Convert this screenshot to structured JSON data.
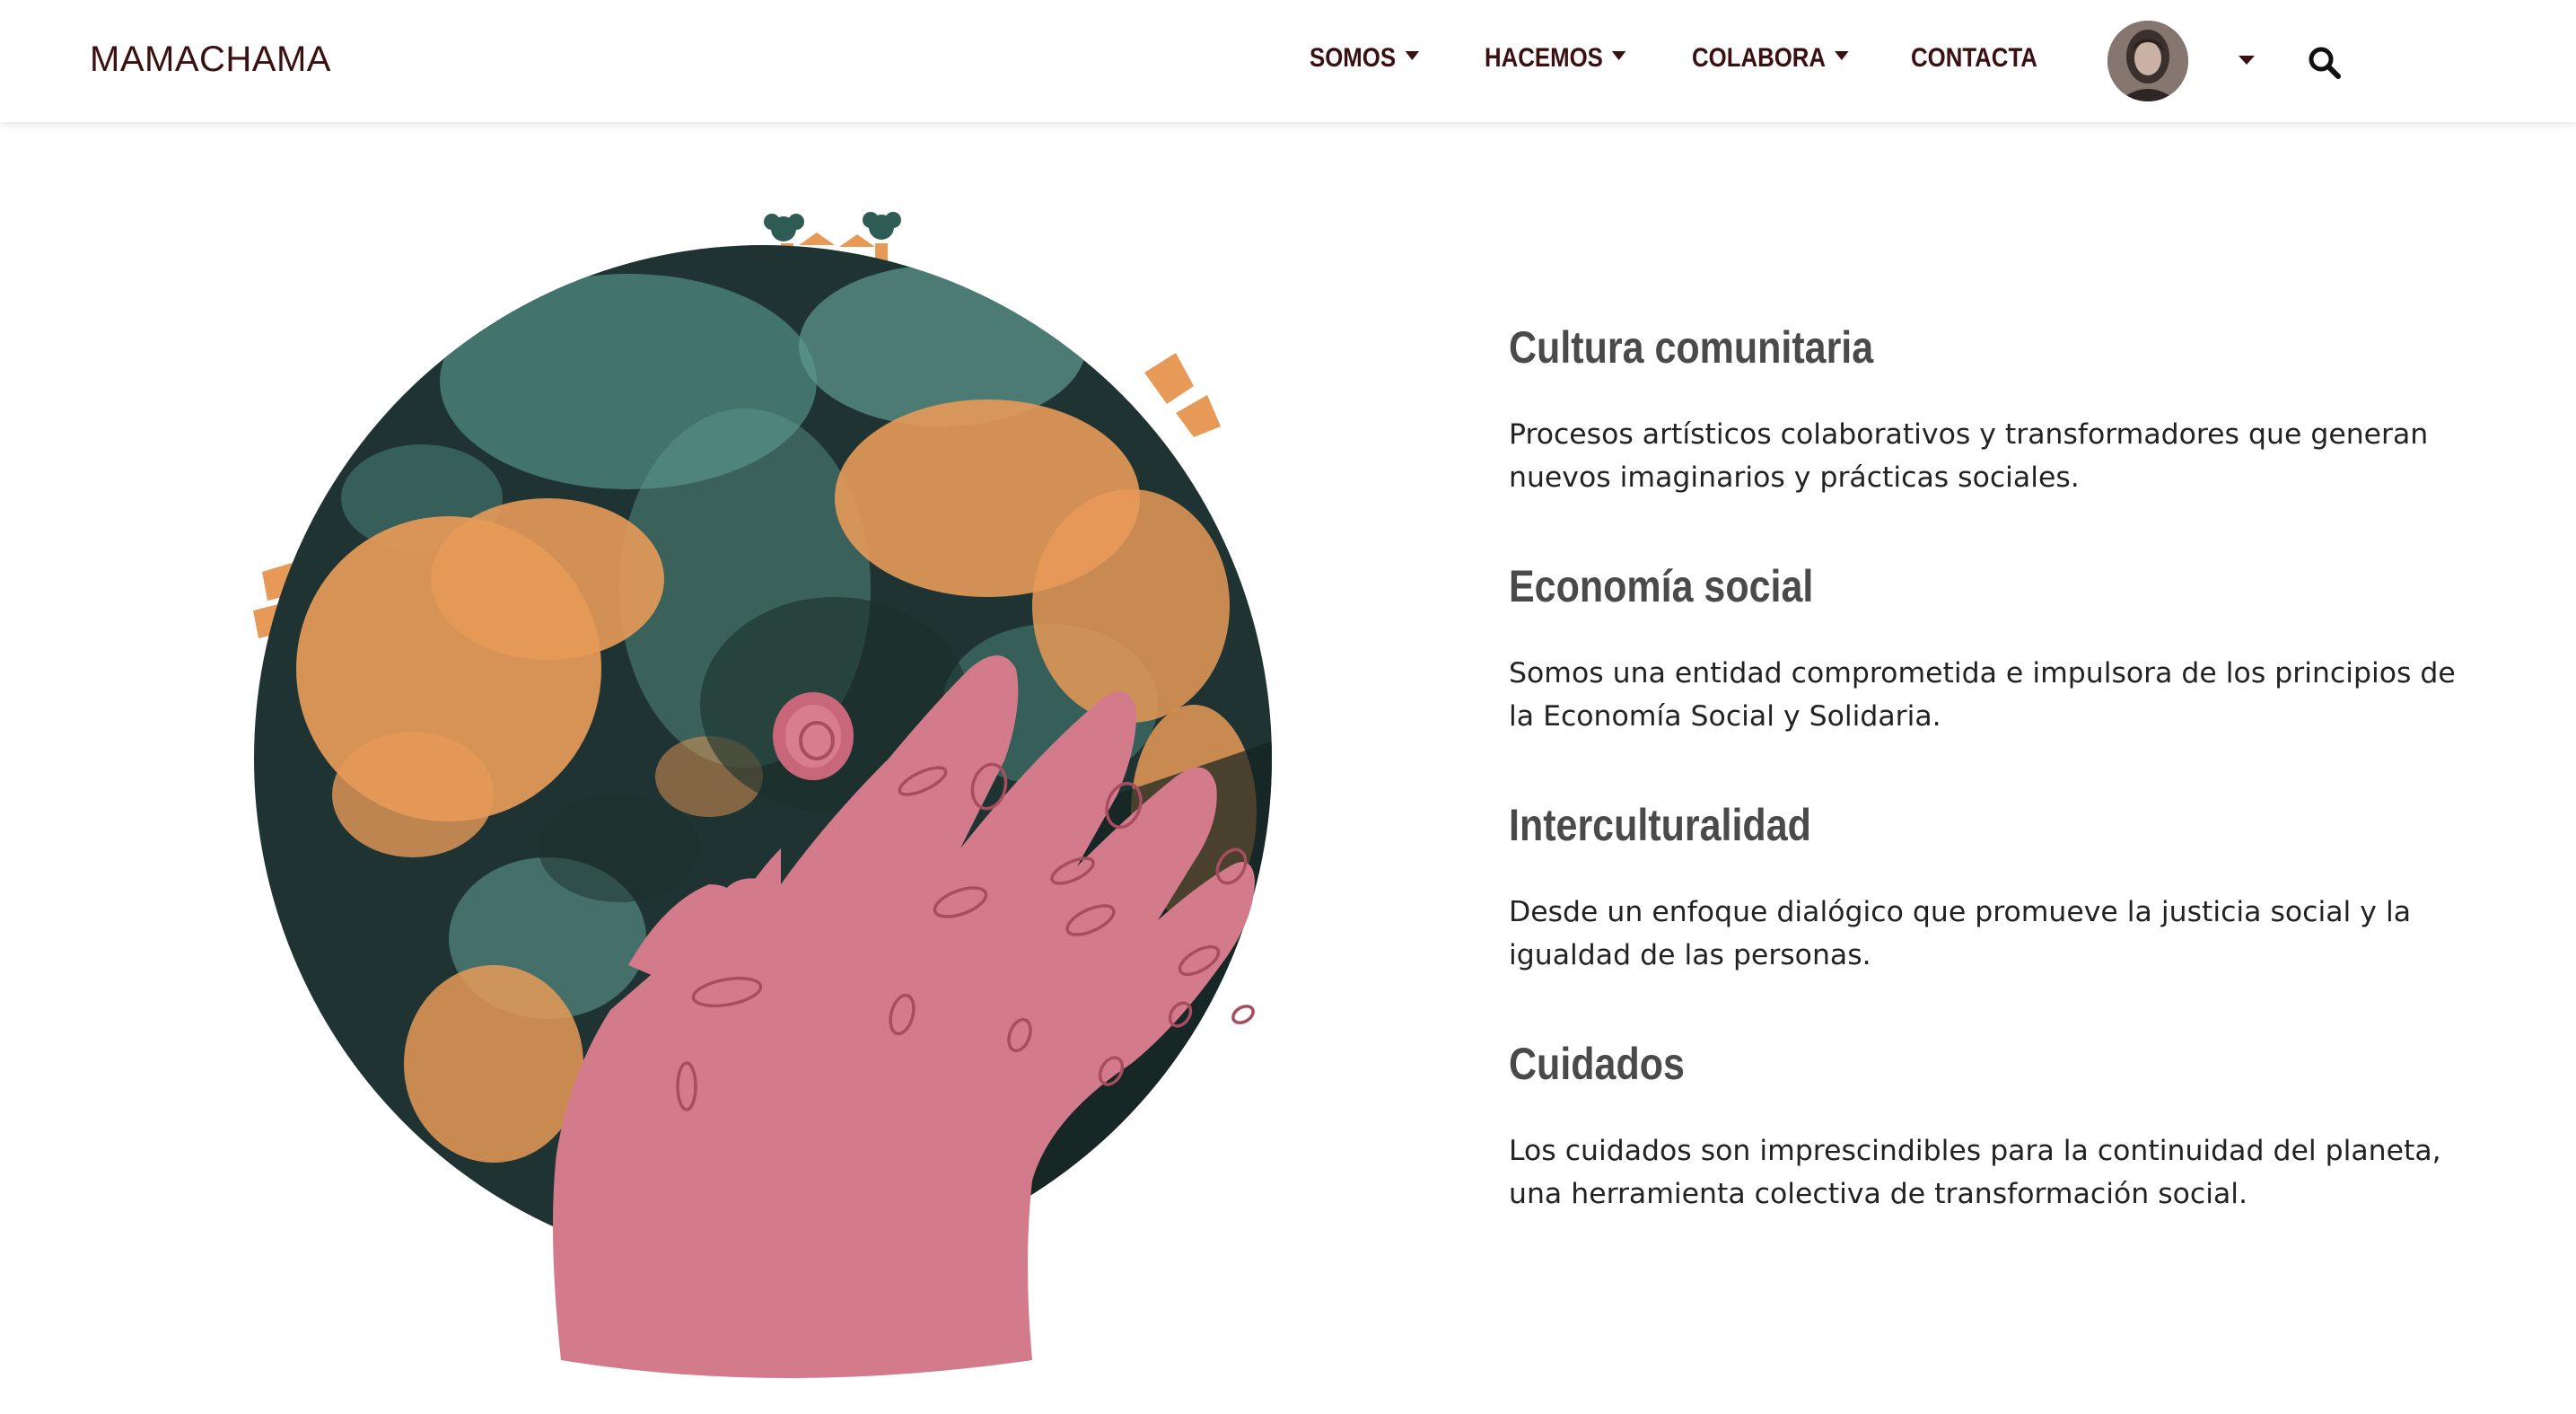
{
  "brand": "MAMACHAMA",
  "nav": {
    "items": [
      {
        "label": "SOMOS",
        "dropdown": true
      },
      {
        "label": "HACEMOS",
        "dropdown": true
      },
      {
        "label": "COLABORA",
        "dropdown": true
      },
      {
        "label": "CONTACTA",
        "dropdown": false
      }
    ],
    "user_menu": {
      "icon": "avatar-photo",
      "dropdown": true
    },
    "search_icon": "search-icon"
  },
  "illustration": {
    "description_icon": "globe-held-by-hand-illustration",
    "colors": {
      "globe_dark": "#1f3432",
      "globe_teal": "#5e9a8e",
      "globe_orange": "#e79a58",
      "hand_pink": "#d77d8e"
    }
  },
  "features": [
    {
      "title": "Cultura comunitaria",
      "text": "Procesos artísticos colaborativos y transformadores que generan nuevos imaginarios y prácticas sociales."
    },
    {
      "title": "Economía social",
      "text": "Somos una entidad comprometida e impulsora de los principios de la Economía Social y Solidaria."
    },
    {
      "title": "Interculturalidad",
      "text": "Desde un enfoque dialógico que promueve la justicia social y la igualdad de las personas."
    },
    {
      "title": "Cuidados",
      "text": "Los cuidados son imprescindibles para la continuidad del planeta, una herramienta colectiva de transformación social."
    }
  ],
  "colors": {
    "nav_text": "#3a1012",
    "heading": "#4a4a4a",
    "body_text": "#222222"
  }
}
